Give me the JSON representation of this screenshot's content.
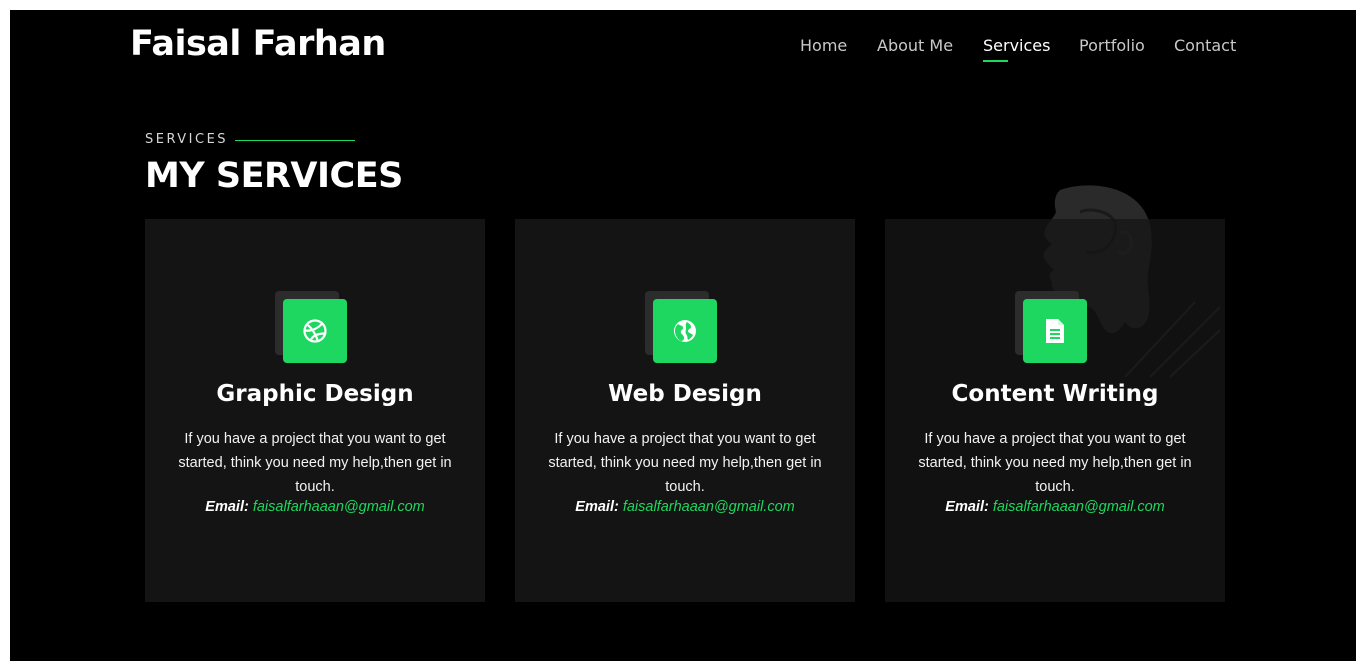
{
  "brand": {
    "name": "Faisal Farhan"
  },
  "nav": {
    "items": [
      {
        "label": "Home",
        "active": false
      },
      {
        "label": "About Me",
        "active": false
      },
      {
        "label": "Services",
        "active": true
      },
      {
        "label": "Portfolio",
        "active": false
      },
      {
        "label": "Contact",
        "active": false
      }
    ]
  },
  "section": {
    "eyebrow": "SERVICES",
    "title": "MY SERVICES"
  },
  "services": [
    {
      "icon": "dribbble-icon",
      "title": "Graphic Design",
      "text": "If you have a project that you want to get started, think you need my help,then get in touch.",
      "email_label": "Email:",
      "email": "faisalfarhaaan@gmail.com"
    },
    {
      "icon": "globe-icon",
      "title": "Web Design",
      "text": "If you have a project that you want to get started, think you need my help,then get in touch.",
      "email_label": "Email:",
      "email": "faisalfarhaaan@gmail.com"
    },
    {
      "icon": "document-icon",
      "title": "Content Writing",
      "text": "If you have a project that you want to get started, think you need my help,then get in touch.",
      "email_label": "Email:",
      "email": "faisalfarhaaan@gmail.com"
    }
  ],
  "colors": {
    "accent": "#1ed760",
    "background": "#000000",
    "card": "#141414"
  }
}
